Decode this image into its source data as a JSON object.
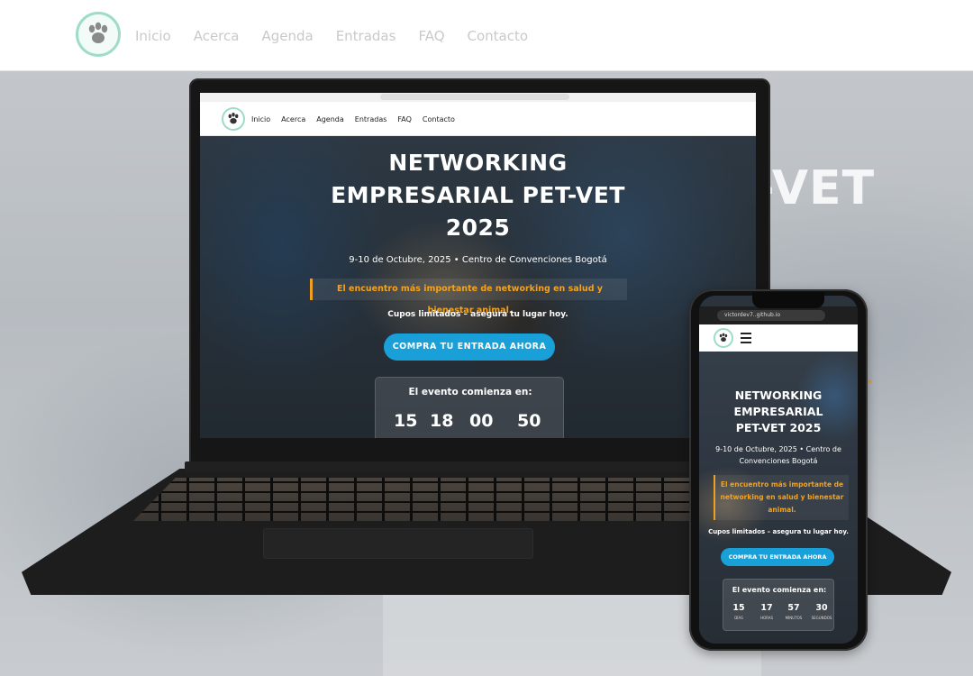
{
  "nav": {
    "items": [
      "Inicio",
      "Acerca",
      "Agenda",
      "Entradas",
      "FAQ",
      "Contacto"
    ]
  },
  "background": {
    "title_fragment": "-VET",
    "countdown": [
      "15",
      "18",
      "00",
      "50"
    ]
  },
  "laptop": {
    "nav_items": [
      "Inicio",
      "Acerca",
      "Agenda",
      "Entradas",
      "FAQ",
      "Contacto"
    ],
    "title_lines": [
      "NETWORKING",
      "EMPRESARIAL PET-VET",
      "2025"
    ],
    "date": "9-10 de Octubre, 2025 • Centro de Convenciones Bogotá",
    "highlight": "El encuentro más importante de networking en salud y bienestar animal.",
    "limited": "Cupos limitados – asegura tu lugar hoy.",
    "cta": "COMPRA TU ENTRADA AHORA",
    "countdown_title": "El evento comienza en:",
    "countdown": [
      "15",
      "18",
      "00",
      "50"
    ]
  },
  "phone": {
    "url": "victordev7..github.io",
    "title_lines": [
      "NETWORKING",
      "EMPRESARIAL",
      "PET-VET 2025"
    ],
    "date": "9-10 de Octubre, 2025 • Centro de Convenciones Bogotá",
    "highlight": "El encuentro más importante de networking en salud y bienestar animal.",
    "limited": "Cupos limitados – asegura tu lugar hoy.",
    "cta": "COMPRA TU ENTRADA AHORA",
    "countdown_title": "El evento comienza en:",
    "countdown": [
      {
        "value": "15",
        "label": "DÍAS"
      },
      {
        "value": "17",
        "label": "HORAS"
      },
      {
        "value": "57",
        "label": "MINUTOS"
      },
      {
        "value": "30",
        "label": "SEGUNDOS"
      }
    ]
  },
  "colors": {
    "accent_blue": "#1aa0d8",
    "accent_orange": "#f2a21e",
    "logo_ring": "#9fdcc6"
  },
  "icons": [
    "paw-logo-icon",
    "hamburger-menu-icon"
  ]
}
